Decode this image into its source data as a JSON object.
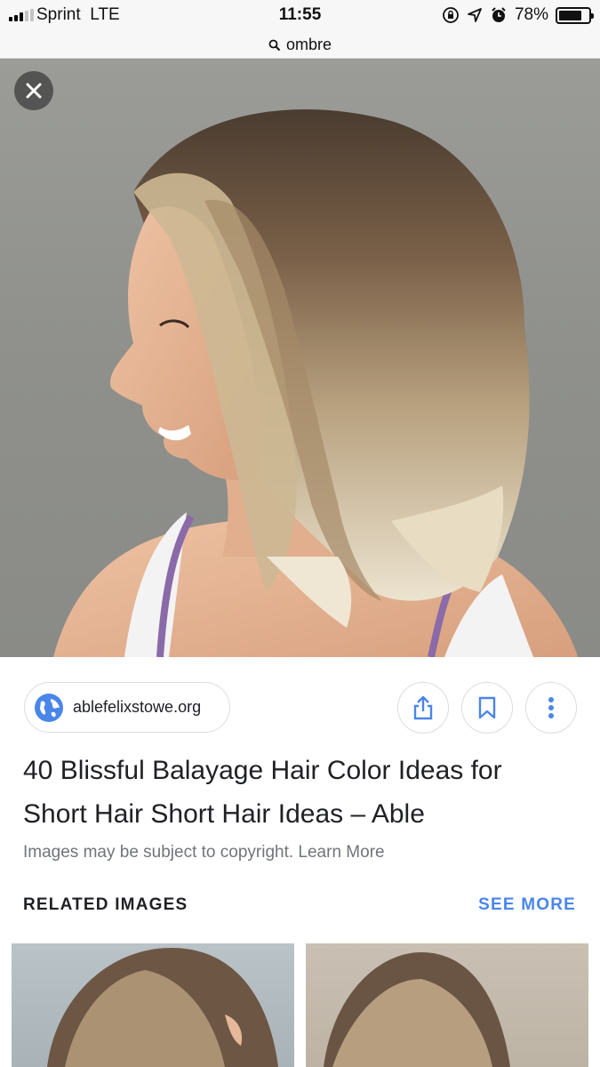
{
  "status_bar": {
    "carrier": "Sprint",
    "network": "LTE",
    "time": "11:55",
    "battery_percent": "78%",
    "battery_level": 0.78,
    "signal_bars_on": 3,
    "signal_bars_total": 5
  },
  "url_bar": {
    "query": "ombre",
    "icon": "search-icon"
  },
  "hero": {
    "close_icon": "close-icon",
    "description_colors": {
      "background": "#8f908c",
      "hair_dark": "#5a4a3c",
      "hair_light": "#e8dcc4",
      "skin": "#e2b496",
      "tank_top": "#f2f2f2",
      "strap": "#8a6aa8"
    }
  },
  "result": {
    "source_domain": "ablefelixstowe.org",
    "source_icon": "globe-icon",
    "actions": [
      {
        "name": "share-button",
        "icon": "share-icon"
      },
      {
        "name": "bookmark-button",
        "icon": "bookmark-icon"
      },
      {
        "name": "more-options-button",
        "icon": "more-vertical-icon"
      }
    ],
    "title": "40 Blissful Balayage Hair Color Ideas for Short Hair Short Hair Ideas – Able",
    "copyright_notice": "Images may be subject to copyright. Learn More"
  },
  "related": {
    "heading": "RELATED IMAGES",
    "see_more": "SEE MORE"
  },
  "colors": {
    "accent": "#4a86e8",
    "text_primary": "#202124",
    "text_secondary": "#70757a",
    "border": "#dadce0"
  }
}
